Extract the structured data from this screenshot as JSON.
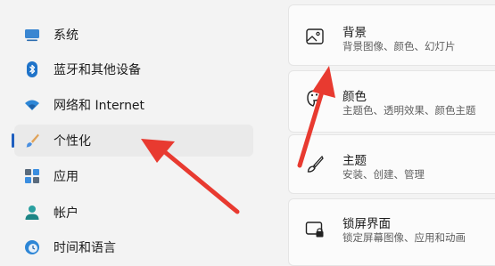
{
  "sidebar": {
    "items": [
      {
        "label": "系统",
        "icon": "monitor-icon"
      },
      {
        "label": "蓝牙和其他设备",
        "icon": "bluetooth-icon"
      },
      {
        "label": "网络和 Internet",
        "icon": "wifi-icon"
      },
      {
        "label": "个性化",
        "icon": "brush-icon",
        "selected": true
      },
      {
        "label": "应用",
        "icon": "apps-icon"
      },
      {
        "label": "帐户",
        "icon": "person-icon"
      },
      {
        "label": "时间和语言",
        "icon": "globe-clock-icon"
      }
    ]
  },
  "cards": [
    {
      "title": "背景",
      "subtitle": "背景图像、颜色、幻灯片",
      "icon": "image-icon"
    },
    {
      "title": "颜色",
      "subtitle": "主题色、透明效果、颜色主题",
      "icon": "palette-icon"
    },
    {
      "title": "主题",
      "subtitle": "安装、创建、管理",
      "icon": "brush-icon"
    },
    {
      "title": "锁屏界面",
      "subtitle": "锁定屏幕图像、应用和动画",
      "icon": "lock-screen-icon"
    }
  ],
  "colors": {
    "accent": "#1f5fbf",
    "arrow": "#e83a30"
  }
}
